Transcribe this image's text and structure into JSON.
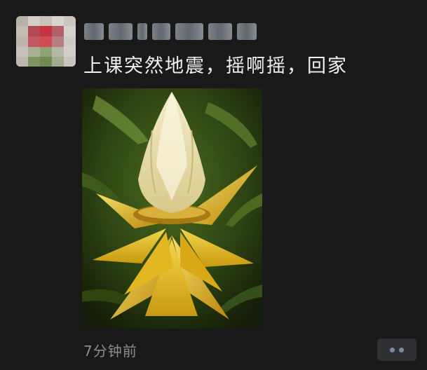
{
  "post": {
    "author_name": "",
    "text": "上课突然地震，摇啊摇，回家",
    "timestamp": "7分钟前",
    "image_alt": "banana flower"
  },
  "icons": {
    "avatar": "avatar-image",
    "more": "more-options-icon"
  },
  "colors": {
    "background": "#191919",
    "text_primary": "#f1f1f1",
    "text_secondary": "#8d8d8d",
    "button_bg": "#2e3033",
    "button_dots": "#7a8aa5"
  }
}
